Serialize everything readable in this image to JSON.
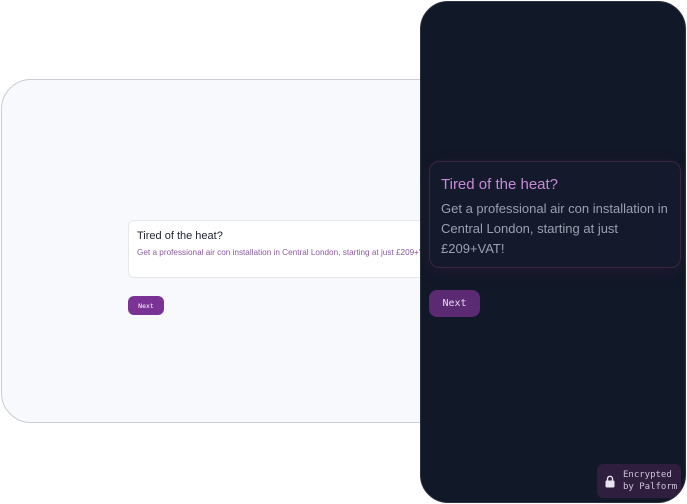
{
  "desktop_preview": {
    "card": {
      "title": "Tired of the heat?",
      "body": "Get a professional air con installation in Central London, starting at just £209+VAT!"
    },
    "next_label": "Next"
  },
  "mobile_preview": {
    "card": {
      "title": "Tired of the heat?",
      "body": "Get a professional air con installation in Central London, starting at just £209+VAT!"
    },
    "next_label": "Next",
    "badge": {
      "icon": "lock-icon",
      "line1": "Encrypted",
      "line2": "by Palform"
    }
  },
  "colors": {
    "accent": "#7a3394",
    "dark_bg": "#111827",
    "light_bg": "#f8f9fc",
    "title_dark": "#c889d9"
  }
}
